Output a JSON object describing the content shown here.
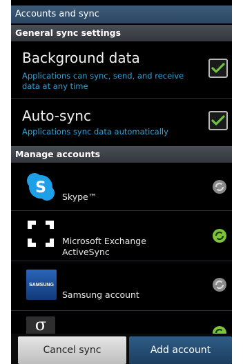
{
  "title": "Accounts and sync",
  "general": {
    "header": "General sync settings",
    "background_data": {
      "title": "Background data",
      "subtitle": "Applications can sync, send, and receive data at any time",
      "checked": true
    },
    "auto_sync": {
      "title": "Auto-sync",
      "subtitle": "Applications sync data automatically",
      "checked": true
    }
  },
  "manage": {
    "header": "Manage accounts",
    "accounts": [
      {
        "name": "Skype™",
        "icon": "skype-icon",
        "sync_status": "off"
      },
      {
        "name": "Microsoft Exchange ActiveSync",
        "icon": "exchange-icon",
        "sync_status": "on"
      },
      {
        "name": "Samsung account",
        "icon": "samsung-icon",
        "icon_text": "SAMSUNG",
        "sync_status": "off"
      },
      {
        "name": "",
        "icon": "sigma-icon",
        "icon_text": "σ",
        "sync_status": "on"
      }
    ]
  },
  "buttons": {
    "cancel": "Cancel sync",
    "add": "Add account"
  },
  "colors": {
    "accent_blue": "#2fa3d6",
    "check_green": "#6ec33f",
    "sync_on": "#7cc43a",
    "sync_off": "#8a8a8a"
  }
}
